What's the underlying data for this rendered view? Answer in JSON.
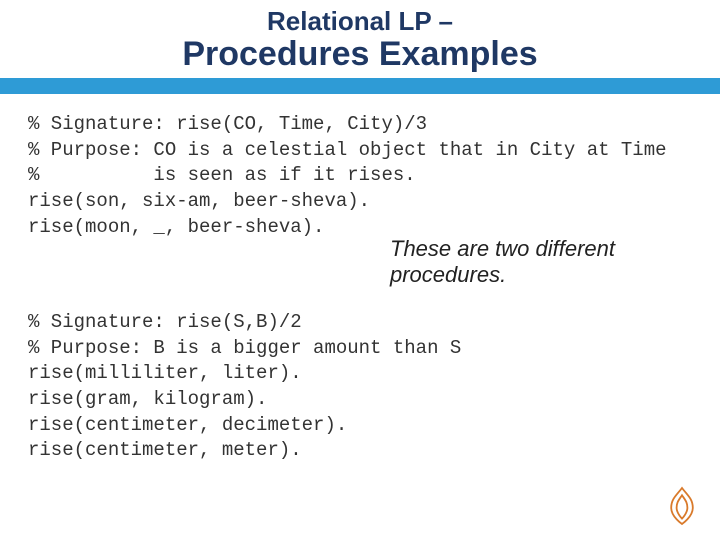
{
  "title": {
    "line1": "Relational LP –",
    "line2": "Procedures Examples"
  },
  "code_block1": "% Signature: rise(CO, Time, City)/3\n% Purpose: CO is a celestial object that in City at Time\n%          is seen as if it rises.\nrise(son, six-am, beer-sheva).\nrise(moon, _, beer-sheva).",
  "annotation": "These are two different procedures.",
  "code_block2": "% Signature: rise(S,B)/2\n% Purpose: B is a bigger amount than S\nrise(milliliter, liter).\nrise(gram, kilogram).\nrise(centimeter, decimeter).\nrise(centimeter, meter)."
}
